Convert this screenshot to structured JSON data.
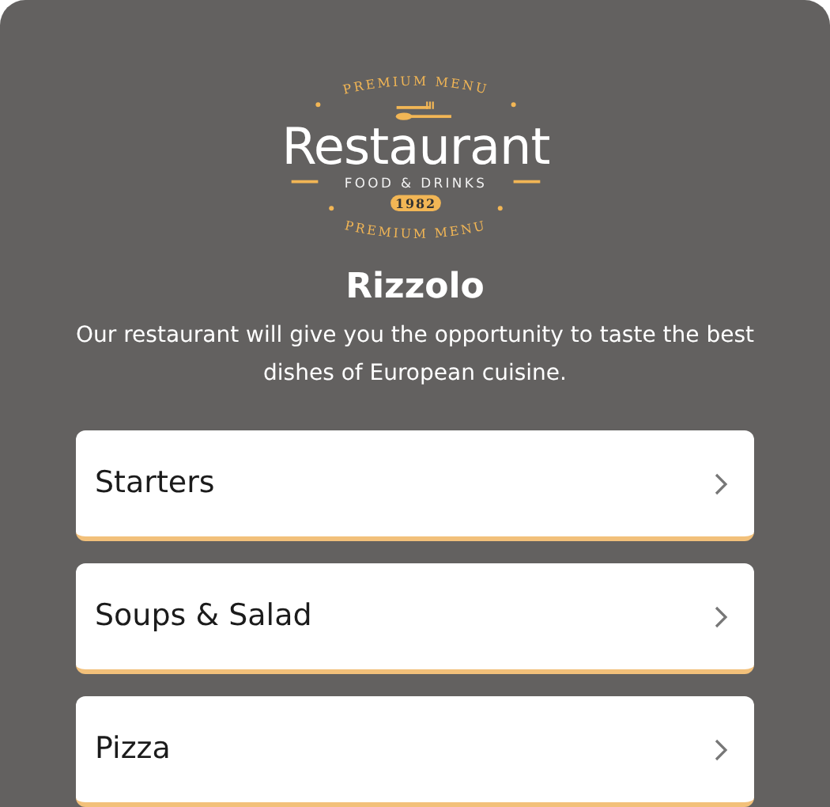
{
  "logo": {
    "top_arc": "PREMIUM MENU",
    "name": "Restaurant",
    "tagline": "FOOD & DRINKS",
    "year": "1982",
    "bottom_arc": "PREMIUM MENU"
  },
  "title": "Rizzolo",
  "description": "Our restaurant will give you the opportunity to taste the best dishes of European cuisine.",
  "categories": [
    {
      "label": "Starters"
    },
    {
      "label": "Soups & Salad"
    },
    {
      "label": "Pizza"
    }
  ]
}
